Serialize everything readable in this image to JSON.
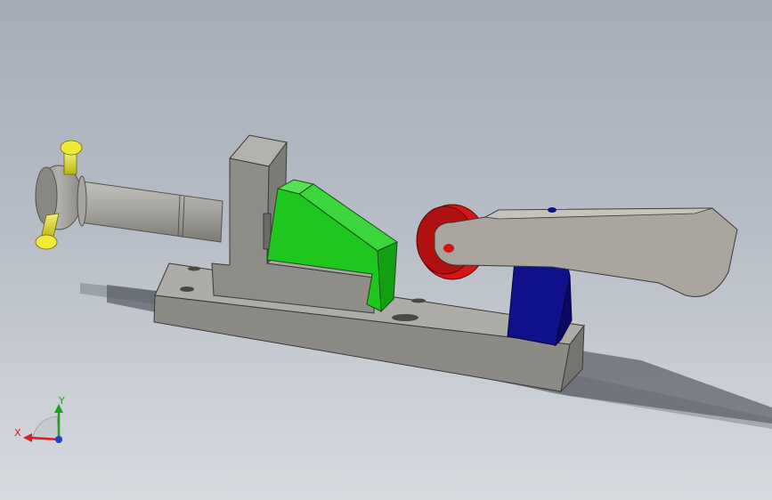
{
  "viewport": {
    "background_top": "#a4acb8",
    "background_bottom": "#d7dadf"
  },
  "model": {
    "parts": [
      {
        "name": "base-plate",
        "color": "#8f8d88"
      },
      {
        "name": "upright-support-block",
        "color": "#8f8d88"
      },
      {
        "name": "shaft",
        "color": "#a09e99"
      },
      {
        "name": "shaft-end-collar",
        "color": "#9b9993"
      },
      {
        "name": "yellow-pin",
        "color": "#e2de2a"
      },
      {
        "name": "green-wedge-jaw",
        "color": "#1ec61e"
      },
      {
        "name": "red-roller",
        "color": "#d41616"
      },
      {
        "name": "blue-pivot-bracket",
        "color": "#10108a"
      },
      {
        "name": "lever-arm",
        "color": "#aaa69f"
      }
    ]
  },
  "triad": {
    "x_label": "X",
    "y_label": "Y",
    "x_color": "#d42020",
    "y_color": "#20a020",
    "z_color": "#2040d0"
  }
}
